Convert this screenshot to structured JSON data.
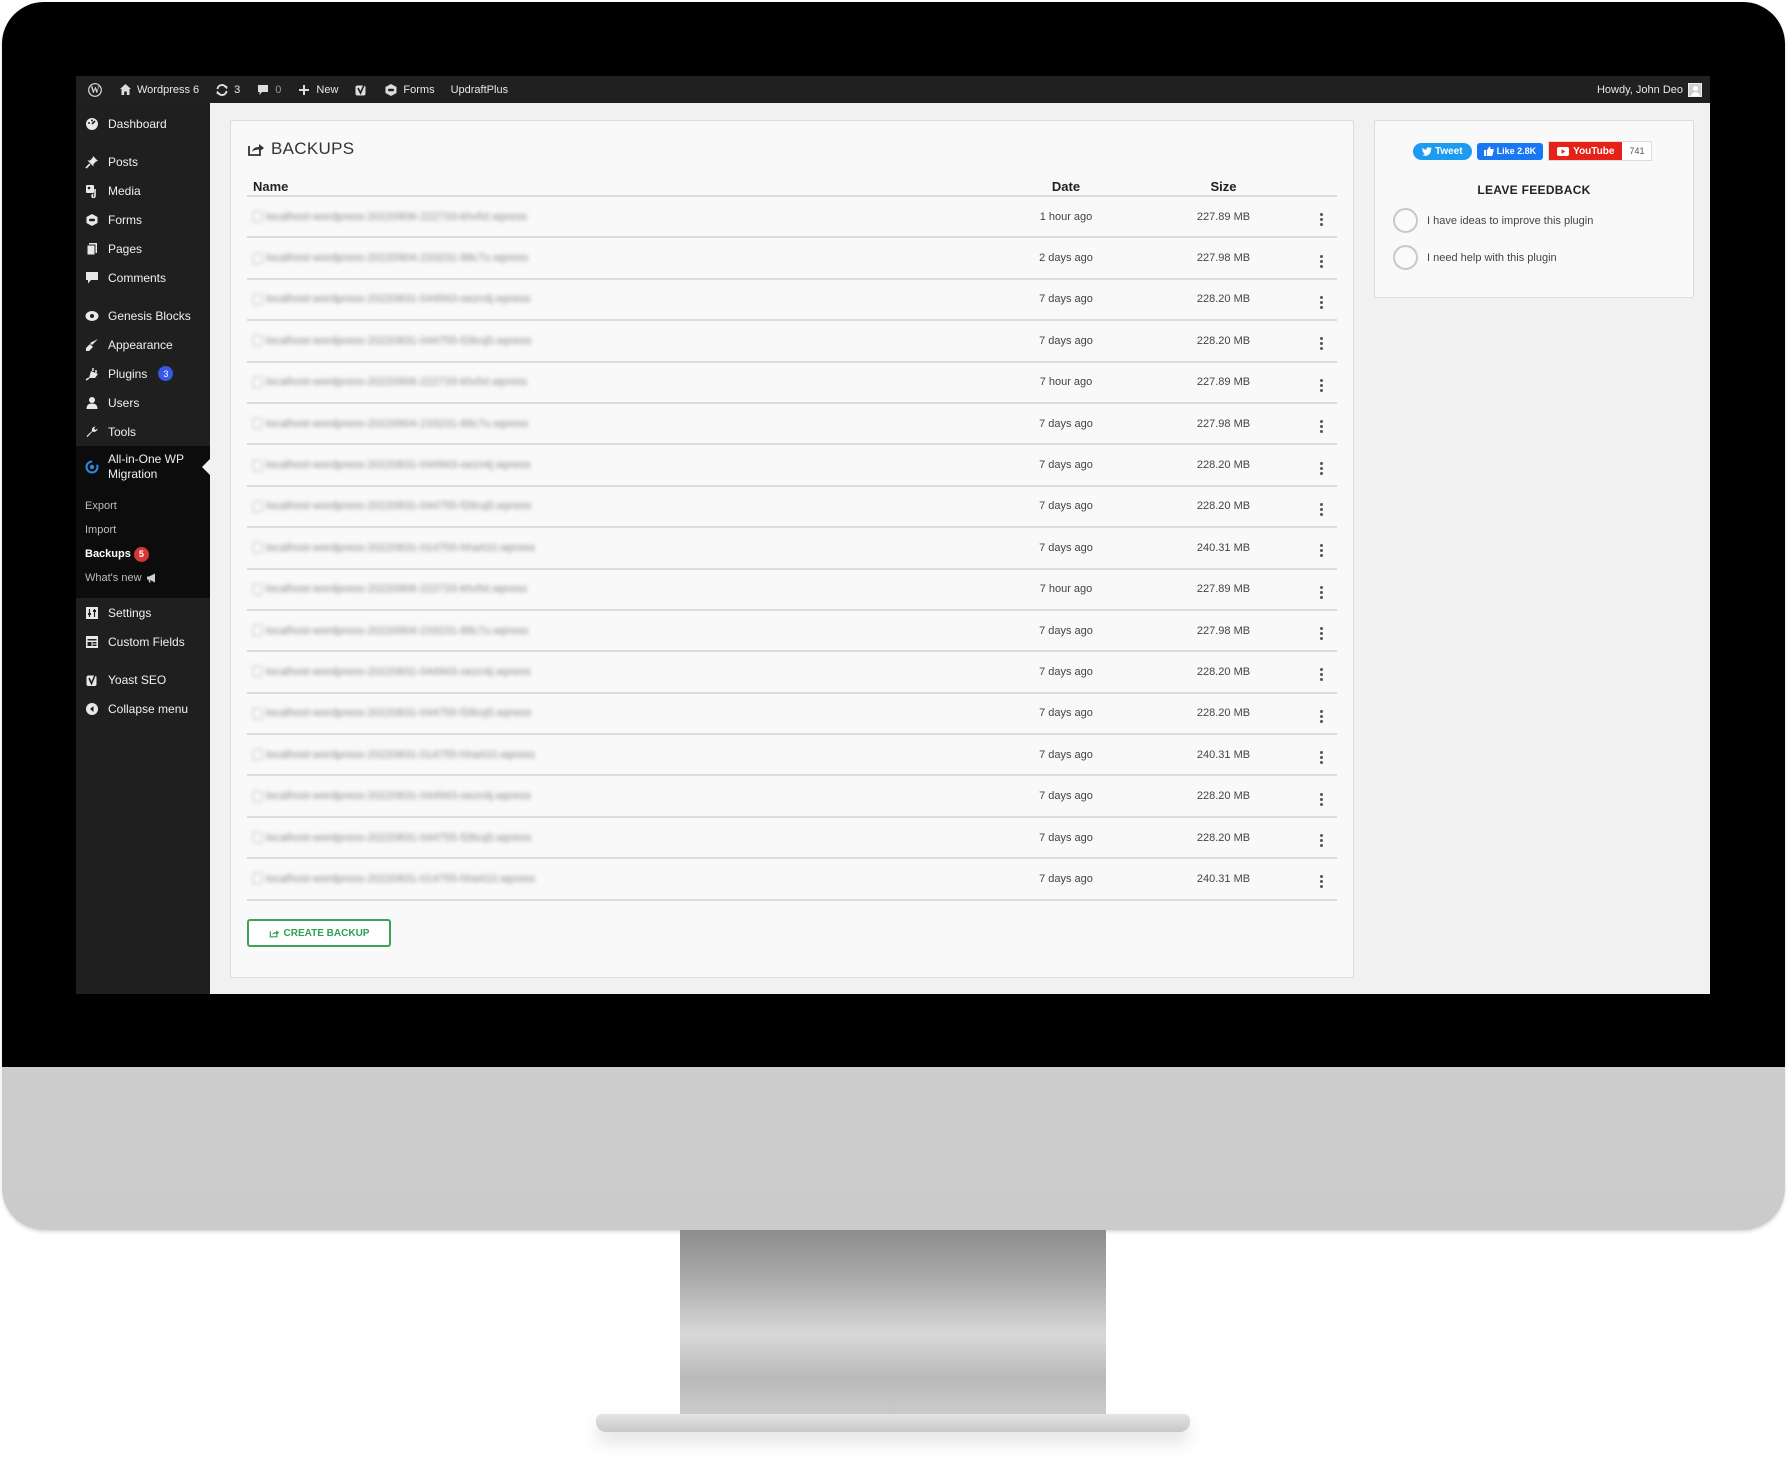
{
  "colors": {
    "adminbar_bg": "#202020",
    "sidebar_bg": "#1f1f1f",
    "plugins_badge": "#3858e9",
    "backups_badge": "#d63638",
    "create_button": "#2ea04f",
    "tweet": "#1d9bf0",
    "like": "#1877f2",
    "youtube": "#e62117"
  },
  "adminbar": {
    "wp_logo_icon": "wordpress-icon",
    "site_name": "Wordpress 6",
    "updates_count": "3",
    "comments_count": "0",
    "new_label": "New",
    "yoast_icon": "yoast-icon",
    "forms_label": "Forms",
    "updraft_label": "UpdraftPlus",
    "howdy": "Howdy, John Deo"
  },
  "sidebar": {
    "items": [
      {
        "label": "Dashboard",
        "icon": "dashboard-icon"
      },
      {
        "label": "Posts",
        "icon": "pin-icon"
      },
      {
        "label": "Media",
        "icon": "media-icon"
      },
      {
        "label": "Forms",
        "icon": "forms-icon"
      },
      {
        "label": "Pages",
        "icon": "pages-icon"
      },
      {
        "label": "Comments",
        "icon": "comment-icon"
      },
      {
        "label": "Genesis Blocks",
        "icon": "genesis-icon"
      },
      {
        "label": "Appearance",
        "icon": "brush-icon"
      },
      {
        "label": "Plugins",
        "icon": "plugin-icon",
        "badge": "3"
      },
      {
        "label": "Users",
        "icon": "user-icon"
      },
      {
        "label": "Tools",
        "icon": "wrench-icon"
      },
      {
        "label": "All-in-One WP Migration",
        "icon": "migration-icon"
      },
      {
        "label": "Settings",
        "icon": "settings-icon"
      },
      {
        "label": "Custom Fields",
        "icon": "custom-fields-icon"
      },
      {
        "label": "Yoast SEO",
        "icon": "yoast-icon"
      },
      {
        "label": "Collapse menu",
        "icon": "collapse-icon"
      }
    ],
    "submenu": [
      {
        "label": "Export"
      },
      {
        "label": "Import"
      },
      {
        "label": "Backups",
        "badge": "5"
      },
      {
        "label": "What's new"
      }
    ]
  },
  "backups": {
    "title": "BACKUPS",
    "columns": {
      "name": "Name",
      "date": "Date",
      "size": "Size"
    },
    "rows": [
      {
        "name": "localhost-wordpress-20220906-222733-khvfxt.wpress",
        "date": "1 hour ago",
        "size": "227.89 MB"
      },
      {
        "name": "localhost-wordpress-20220904-233231-88c7u.wpress",
        "date": "2 days ago",
        "size": "227.98 MB"
      },
      {
        "name": "localhost-wordpress-20220831-044943-oezn4j.wpress",
        "date": "7 days ago",
        "size": "228.20 MB"
      },
      {
        "name": "localhost-wordpress-20220831-044755-f28cq5.wpress",
        "date": "7 days ago",
        "size": "228.20 MB"
      },
      {
        "name": "localhost-wordpress-20220906-222733-khvfxt.wpress",
        "date": "7 hour ago",
        "size": "227.89 MB"
      },
      {
        "name": "localhost-wordpress-20220904-233231-88c7u.wpress",
        "date": "7 days ago",
        "size": "227.98 MB"
      },
      {
        "name": "localhost-wordpress-20220831-044943-oezn4j.wpress",
        "date": "7 days ago",
        "size": "228.20 MB"
      },
      {
        "name": "localhost-wordpress-20220831-044755-f28cq5.wpress",
        "date": "7 days ago",
        "size": "228.20 MB"
      },
      {
        "name": "localhost-wordpress-20220831-014755-hha410.wpress",
        "date": "7 days ago",
        "size": "240.31 MB"
      },
      {
        "name": "localhost-wordpress-20220906-222733-khvfxt.wpress",
        "date": "7 hour ago",
        "size": "227.89 MB"
      },
      {
        "name": "localhost-wordpress-20220904-233231-88c7u.wpress",
        "date": "7 days ago",
        "size": "227.98 MB"
      },
      {
        "name": "localhost-wordpress-20220831-044943-oezn4j.wpress",
        "date": "7 days ago",
        "size": "228.20 MB"
      },
      {
        "name": "localhost-wordpress-20220831-044755-f28cq5.wpress",
        "date": "7 days ago",
        "size": "228.20 MB"
      },
      {
        "name": "localhost-wordpress-20220831-014755-hha410.wpress",
        "date": "7 days ago",
        "size": "240.31 MB"
      },
      {
        "name": "localhost-wordpress-20220831-044943-oezn4j.wpress",
        "date": "7 days ago",
        "size": "228.20 MB"
      },
      {
        "name": "localhost-wordpress-20220831-044755-f28cq5.wpress",
        "date": "7 days ago",
        "size": "228.20 MB"
      },
      {
        "name": "localhost-wordpress-20220831-014755-hha410.wpress",
        "date": "7 days ago",
        "size": "240.31 MB"
      }
    ],
    "create_button": "CREATE BACKUP"
  },
  "feedback": {
    "tweet": "Tweet",
    "like": "Like 2.8K",
    "youtube": "YouTube",
    "youtube_count": "741",
    "title": "LEAVE FEEDBACK",
    "options": [
      "I have ideas to improve this plugin",
      "I need help with this plugin"
    ]
  }
}
